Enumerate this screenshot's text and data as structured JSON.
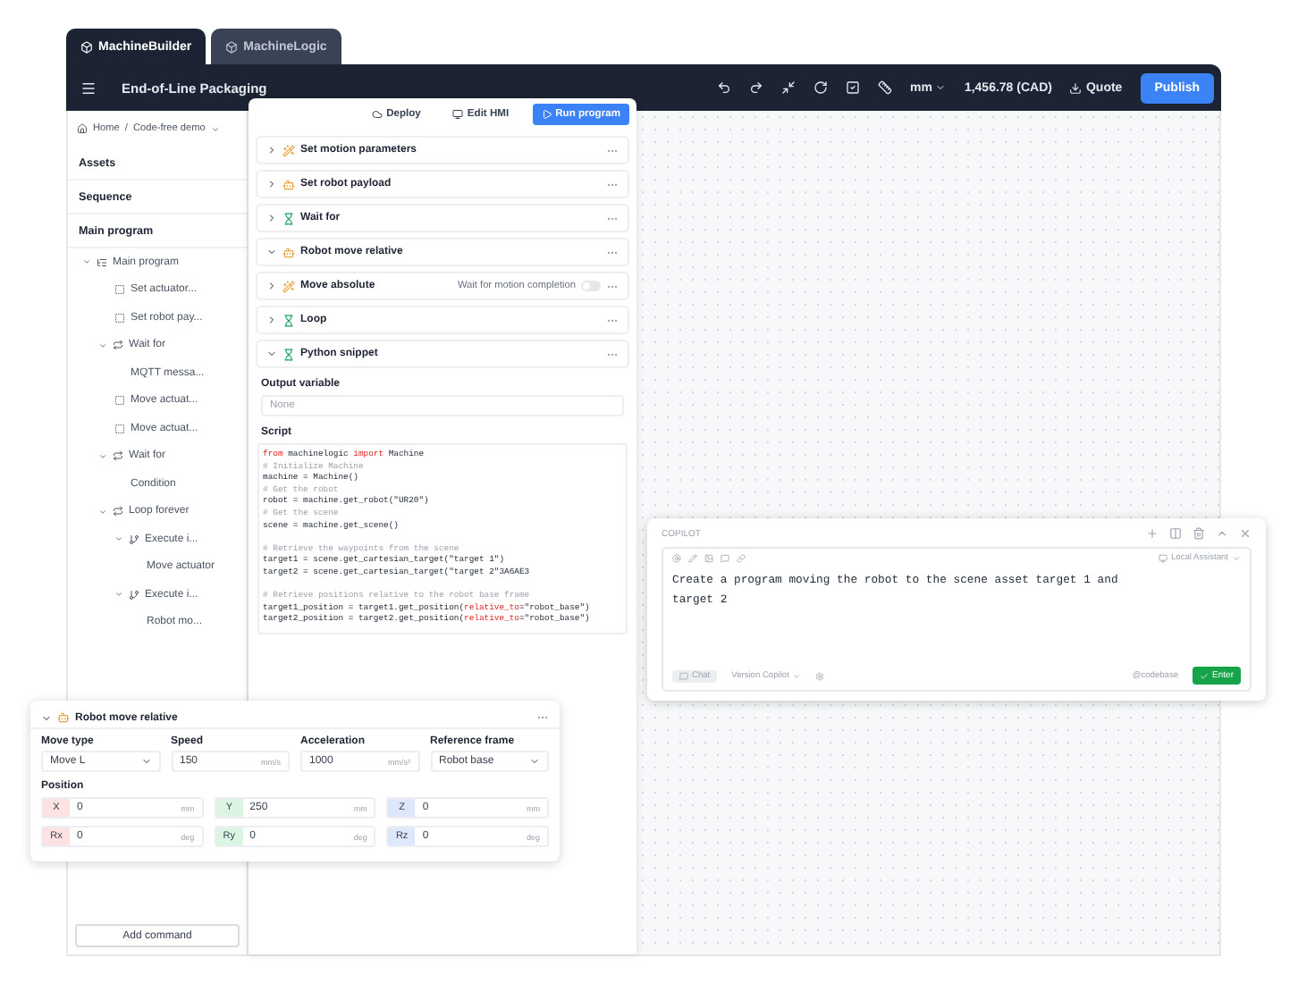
{
  "tabs": [
    {
      "label": "MachineBuilder",
      "selected": true
    },
    {
      "label": "MachineLogic",
      "selected": false
    }
  ],
  "header": {
    "title": "End-of-Line Packaging",
    "unit": "mm",
    "price": "1,456.78 (CAD)",
    "quote": "Quote",
    "publish": "Publish"
  },
  "breadcrumb": [
    "Home",
    "Code-free demo"
  ],
  "breadcrumb_separator": "/",
  "sections": [
    "Assets",
    "Sequence",
    "Main program"
  ],
  "tree": [
    {
      "label": "Main program",
      "kind": "program",
      "expanded": true,
      "children": [
        {
          "label": "Set actuator...",
          "kind": "command"
        },
        {
          "label": "Set robot pay...",
          "kind": "command"
        },
        {
          "label": "Wait for",
          "kind": "block",
          "expanded": true,
          "children": [
            {
              "label": "MQTT messa..."
            }
          ]
        },
        {
          "label": "Move actuat...",
          "kind": "command"
        },
        {
          "label": "Move actuat...",
          "kind": "command"
        },
        {
          "label": "Wait for",
          "kind": "block",
          "expanded": true,
          "children": [
            {
              "label": "Condition"
            }
          ]
        },
        {
          "label": "Loop forever",
          "kind": "block",
          "expanded": true,
          "children": [
            {
              "label": "Execute i...",
              "kind": "branch",
              "expanded": true,
              "children": [
                {
                  "label": "Move actuator"
                }
              ]
            },
            {
              "label": "Execute i...",
              "kind": "branch",
              "expanded": true,
              "children": [
                {
                  "label": "Robot mo..."
                }
              ]
            }
          ]
        }
      ]
    }
  ],
  "actions": {
    "deploy": "Deploy",
    "edit_hmi": "Edit HMI",
    "run": "Run program"
  },
  "commands": [
    {
      "label": "Set motion parameters",
      "kind": "motion",
      "expanded": false
    },
    {
      "label": "Set robot payload",
      "kind": "robot",
      "expanded": false
    },
    {
      "label": "Wait for",
      "kind": "wait",
      "expanded": false
    },
    {
      "label": "Robot move relative",
      "kind": "robot",
      "expanded": true
    },
    {
      "label": "Move absolute",
      "kind": "motion",
      "expanded": false,
      "toggle": {
        "label": "Wait for motion completion",
        "on": false
      }
    },
    {
      "label": "Loop",
      "kind": "wait",
      "expanded": false
    },
    {
      "label": "Python snippet",
      "kind": "wait",
      "expanded": true
    }
  ],
  "snippet": {
    "output_label": "Output variable",
    "output_placeholder": "None",
    "script_label": "Script",
    "lines": [
      {
        "kind": "code",
        "segments": [
          {
            "text": "from",
            "kind": "kw"
          },
          {
            "text": " machinelogic ",
            "kind": "plain"
          },
          {
            "text": "import",
            "kind": "kw"
          },
          {
            "text": " Machine",
            "kind": "plain"
          }
        ]
      },
      {
        "kind": "code",
        "segments": [
          {
            "text": "# Initialize Machine",
            "kind": "comment"
          }
        ]
      },
      {
        "kind": "code",
        "segments": [
          {
            "text": "machine = Machine()",
            "kind": "plain"
          }
        ]
      },
      {
        "kind": "code",
        "segments": [
          {
            "text": "# Get the robot",
            "kind": "comment"
          }
        ]
      },
      {
        "kind": "code",
        "segments": [
          {
            "text": "robot = machine.get_robot(\"UR20\")",
            "kind": "plain"
          }
        ]
      },
      {
        "kind": "code",
        "segments": [
          {
            "text": "# Get the scene",
            "kind": "comment"
          }
        ]
      },
      {
        "kind": "code",
        "segments": [
          {
            "text": "scene = machine.get_scene()",
            "kind": "plain"
          }
        ]
      },
      {
        "kind": "blank"
      },
      {
        "kind": "code",
        "segments": [
          {
            "text": "# Retrieve the waypoints from the scene",
            "kind": "comment"
          }
        ]
      },
      {
        "kind": "code",
        "segments": [
          {
            "text": "target1 = scene.get_cartesian_target(\"target 1\")",
            "kind": "plain"
          }
        ]
      },
      {
        "kind": "code",
        "segments": [
          {
            "text": "target2 = scene.get_cartesian_target(\"target 2\"3A6AE3",
            "kind": "plain"
          }
        ]
      },
      {
        "kind": "blank"
      },
      {
        "kind": "code",
        "segments": [
          {
            "text": "# Retrieve positions relative to the robot base frame",
            "kind": "comment"
          }
        ]
      },
      {
        "kind": "code",
        "segments": [
          {
            "text": "target1_position = target1.get_position(",
            "kind": "plain"
          },
          {
            "text": "relative_to",
            "kind": "kw"
          },
          {
            "text": "=\"robot_base\")",
            "kind": "plain"
          }
        ]
      },
      {
        "kind": "code",
        "segments": [
          {
            "text": "target2_position = target2.get_position(",
            "kind": "plain"
          },
          {
            "text": "relative_to",
            "kind": "kw"
          },
          {
            "text": "=\"robot_base\")",
            "kind": "plain"
          }
        ]
      }
    ]
  },
  "add_command": "Add command",
  "popup": {
    "title": "Robot move relative",
    "expanded": true,
    "fields": [
      {
        "label": "Move type",
        "kind": "select",
        "value": "Move L"
      },
      {
        "label": "Speed",
        "kind": "number",
        "value": "150",
        "unit": "mm/s"
      },
      {
        "label": "Acceleration",
        "kind": "number",
        "value": "1000",
        "unit": "mm/s²"
      },
      {
        "label": "Reference frame",
        "kind": "select",
        "value": "Robot base"
      }
    ],
    "position_label": "Position",
    "axes": [
      {
        "axis": "X",
        "value": "0",
        "unit": "mm",
        "color": "#fde2e2"
      },
      {
        "axis": "Y",
        "value": "250",
        "unit": "mm",
        "color": "#dcf5e3"
      },
      {
        "axis": "Z",
        "value": "0",
        "unit": "mm",
        "color": "#dde8fb"
      },
      {
        "axis": "Rx",
        "value": "0",
        "unit": "deg",
        "color": "#fde2e2"
      },
      {
        "axis": "Ry",
        "value": "0",
        "unit": "deg",
        "color": "#dcf5e3"
      },
      {
        "axis": "Rz",
        "value": "0",
        "unit": "deg",
        "color": "#dde8fb"
      }
    ]
  },
  "copilot": {
    "title": "COPILOT",
    "assistant": "Local Assistant",
    "prompt": "Create a program moving the robot to the scene asset target 1 and target 2",
    "mode": "Chat",
    "version": "Version Copilot",
    "context": "@codebase",
    "send": "Enter"
  }
}
